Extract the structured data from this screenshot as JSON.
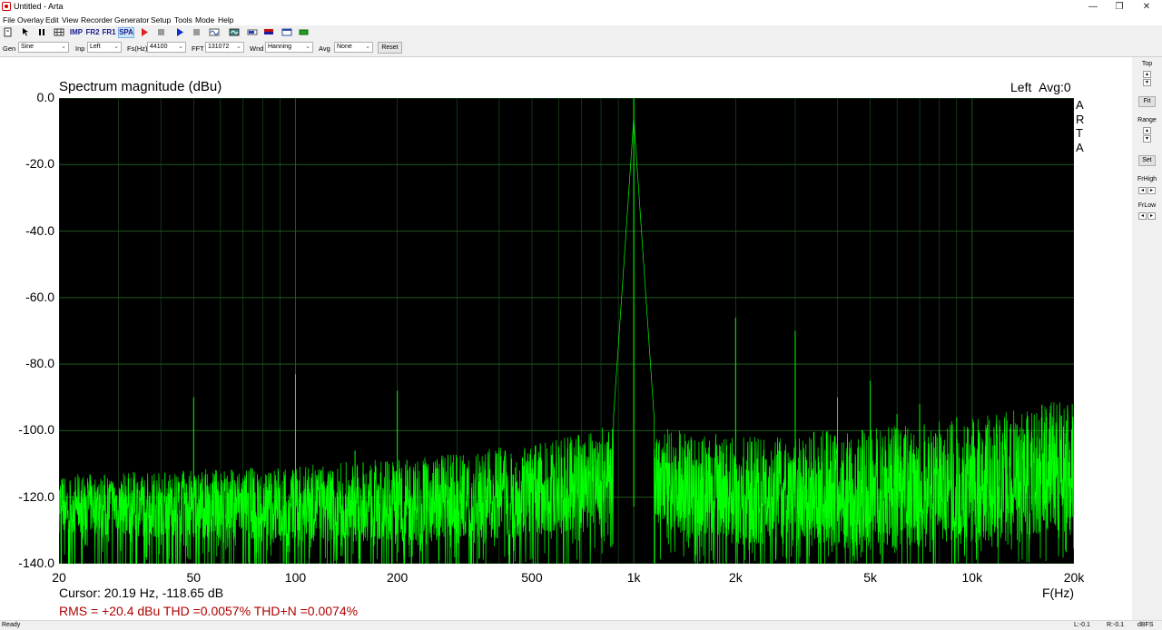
{
  "window": {
    "title": "Untitled - Arta",
    "minimize": "—",
    "restore": "❐",
    "close": "✕"
  },
  "menu": [
    "File",
    "Overlay",
    "Edit",
    "View",
    "Recorder",
    "Generator",
    "Setup",
    "Tools",
    "Mode",
    "Help"
  ],
  "toolbar": {
    "imp": "IMP",
    "fr2": "FR2",
    "fr1": "FR1",
    "spa": "SPA"
  },
  "controls": {
    "gen_label": "Gen",
    "gen_value": "Sine",
    "inp_label": "Inp",
    "inp_value": "Left",
    "fs_label": "Fs(Hz)",
    "fs_value": "44100",
    "fft_label": "FFT",
    "fft_value": "131072",
    "wnd_label": "Wnd",
    "wnd_value": "Hanning",
    "avg_label": "Avg",
    "avg_value": "None",
    "reset": "Reset"
  },
  "side": {
    "top": "Top",
    "fit": "Fit",
    "range": "Range",
    "set": "Set",
    "frhigh": "FrHigh",
    "frlow": "FrLow"
  },
  "status": {
    "ready": "Ready",
    "left": "L:-0.1",
    "right": "R:-0.1",
    "unit": "dBFS"
  },
  "chart_data": {
    "type": "line",
    "title": "Spectrum magnitude (dBu)",
    "channel": "Left",
    "avg": "Avg:0",
    "watermark": [
      "A",
      "R",
      "T",
      "A"
    ],
    "xlabel": "F(Hz)",
    "x_scale": "log",
    "xlim": [
      20,
      20000
    ],
    "ylim": [
      -140,
      0
    ],
    "yticks": [
      {
        "value": 0,
        "label": "0.0"
      },
      {
        "value": -20,
        "label": "-20.0"
      },
      {
        "value": -40,
        "label": "-40.0"
      },
      {
        "value": -60,
        "label": "-60.0"
      },
      {
        "value": -80,
        "label": "-80.0"
      },
      {
        "value": -100,
        "label": "-100.0"
      },
      {
        "value": -120,
        "label": "-120.0"
      },
      {
        "value": -140,
        "label": "-140.0"
      }
    ],
    "xticks": [
      {
        "value": 20,
        "label": "20"
      },
      {
        "value": 50,
        "label": "50"
      },
      {
        "value": 100,
        "label": "100"
      },
      {
        "value": 200,
        "label": "200"
      },
      {
        "value": 500,
        "label": "500"
      },
      {
        "value": 1000,
        "label": "1k"
      },
      {
        "value": 2000,
        "label": "2k"
      },
      {
        "value": 5000,
        "label": "5k"
      },
      {
        "value": 10000,
        "label": "10k"
      },
      {
        "value": 20000,
        "label": "20k"
      }
    ],
    "grid": true,
    "background": "#000000",
    "line_color": "#00ff00",
    "grid_color": "#1e5a1e",
    "fundamental_hz": 1000,
    "peaks": [
      {
        "freq": 50,
        "db": -90
      },
      {
        "freq": 100,
        "db": -83
      },
      {
        "freq": 150,
        "db": -106
      },
      {
        "freq": 200,
        "db": -88
      },
      {
        "freq": 300,
        "db": -108
      },
      {
        "freq": 400,
        "db": -106
      },
      {
        "freq": 600,
        "db": -105
      },
      {
        "freq": 800,
        "db": -104
      },
      {
        "freq": 1000,
        "db": 0
      },
      {
        "freq": 2000,
        "db": -66
      },
      {
        "freq": 3000,
        "db": -70
      },
      {
        "freq": 4000,
        "db": -90
      },
      {
        "freq": 5000,
        "db": -85
      },
      {
        "freq": 6000,
        "db": -95
      },
      {
        "freq": 7000,
        "db": -92
      },
      {
        "freq": 8000,
        "db": -100
      },
      {
        "freq": 9000,
        "db": -96
      },
      {
        "freq": 11000,
        "db": -100
      },
      {
        "freq": 13000,
        "db": -98
      },
      {
        "freq": 15000,
        "db": -102
      },
      {
        "freq": 17000,
        "db": -100
      },
      {
        "freq": 19000,
        "db": -97
      }
    ],
    "noise_floor": [
      {
        "freq": 20,
        "db": -122
      },
      {
        "freq": 100,
        "db": -122
      },
      {
        "freq": 300,
        "db": -120
      },
      {
        "freq": 600,
        "db": -117
      },
      {
        "freq": 900,
        "db": -112
      },
      {
        "freq": 2000,
        "db": -118
      },
      {
        "freq": 5000,
        "db": -117
      },
      {
        "freq": 10000,
        "db": -115
      },
      {
        "freq": 20000,
        "db": -110
      }
    ]
  },
  "readout": {
    "cursor": "Cursor: 20.19 Hz, -118.65 dB",
    "rms": "RMS =  +20.4 dBu THD =0.0057% THD+N =0.0074%"
  }
}
